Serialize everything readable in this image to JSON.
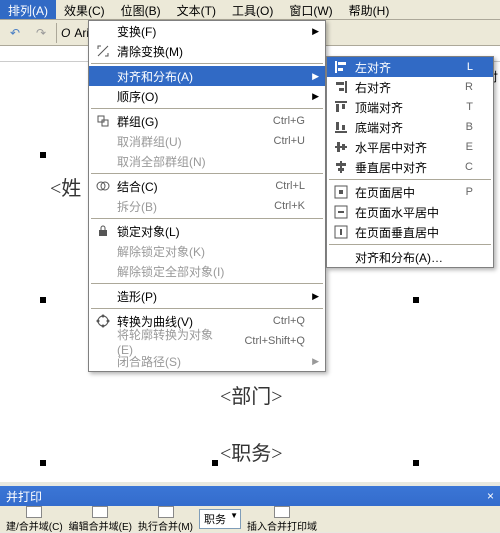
{
  "menubar": {
    "items": [
      "排列(A)",
      "效果(C)",
      "位图(B)",
      "文本(T)",
      "工具(O)",
      "窗口(W)",
      "帮助(H)"
    ],
    "active_index": 0
  },
  "toolbar": {
    "font_name": "Arial",
    "font_style": "O"
  },
  "menu1": {
    "items": [
      {
        "label": "变换(F)",
        "arrow": true
      },
      {
        "label": "清除变换(M)",
        "icon": "clear"
      },
      {
        "sep": true
      },
      {
        "label": "对齐和分布(A)",
        "arrow": true,
        "hover": true
      },
      {
        "label": "顺序(O)",
        "arrow": true
      },
      {
        "sep": true
      },
      {
        "label": "群组(G)",
        "shortcut": "Ctrl+G",
        "icon": "group"
      },
      {
        "label": "取消群组(U)",
        "shortcut": "Ctrl+U",
        "disabled": true,
        "icon": "ungroup"
      },
      {
        "label": "取消全部群组(N)",
        "disabled": true,
        "icon": "ungroup-all"
      },
      {
        "sep": true
      },
      {
        "label": "结合(C)",
        "shortcut": "Ctrl+L",
        "icon": "combine"
      },
      {
        "label": "拆分(B)",
        "shortcut": "Ctrl+K",
        "disabled": true,
        "icon": "split"
      },
      {
        "sep": true
      },
      {
        "label": "锁定对象(L)",
        "icon": "lock"
      },
      {
        "label": "解除锁定对象(K)",
        "disabled": true,
        "icon": "unlock"
      },
      {
        "label": "解除锁定全部对象(I)",
        "disabled": true,
        "icon": "unlock-all"
      },
      {
        "sep": true
      },
      {
        "label": "造形(P)",
        "arrow": true
      },
      {
        "sep": true
      },
      {
        "label": "转换为曲线(V)",
        "shortcut": "Ctrl+Q",
        "icon": "curve"
      },
      {
        "label": "将轮廓转换为对象(E)",
        "shortcut": "Ctrl+Shift+Q",
        "disabled": true
      },
      {
        "label": "闭合路径(S)",
        "disabled": true,
        "arrow": true
      }
    ]
  },
  "menu2": {
    "items": [
      {
        "label": "左对齐",
        "shortcut": "L",
        "icon": "align-left",
        "hover": true
      },
      {
        "label": "右对齐",
        "shortcut": "R",
        "icon": "align-right"
      },
      {
        "label": "顶端对齐",
        "shortcut": "T",
        "icon": "align-top"
      },
      {
        "label": "底端对齐",
        "shortcut": "B",
        "icon": "align-bottom"
      },
      {
        "label": "水平居中对齐",
        "shortcut": "E",
        "icon": "align-hcenter"
      },
      {
        "label": "垂直居中对齐",
        "shortcut": "C",
        "icon": "align-vcenter"
      },
      {
        "sep": true
      },
      {
        "label": "在页面居中",
        "shortcut": "P",
        "icon": "page-center"
      },
      {
        "label": "在页面水平居中",
        "icon": "page-hcenter"
      },
      {
        "label": "在页面垂直居中",
        "icon": "page-vcenter"
      },
      {
        "sep": true
      },
      {
        "label": "对齐和分布(A)…"
      }
    ]
  },
  "canvas": {
    "field1": "<姓",
    "field2": "<部门>",
    "field3": "<职务>",
    "side_label": "左对"
  },
  "bottom": {
    "title": "并打印",
    "close": "×",
    "items": [
      "建/合并域(C)",
      "编辑合并域(E)",
      "执行合并(M)",
      "插入合并打印域"
    ],
    "select_value": "职务"
  }
}
